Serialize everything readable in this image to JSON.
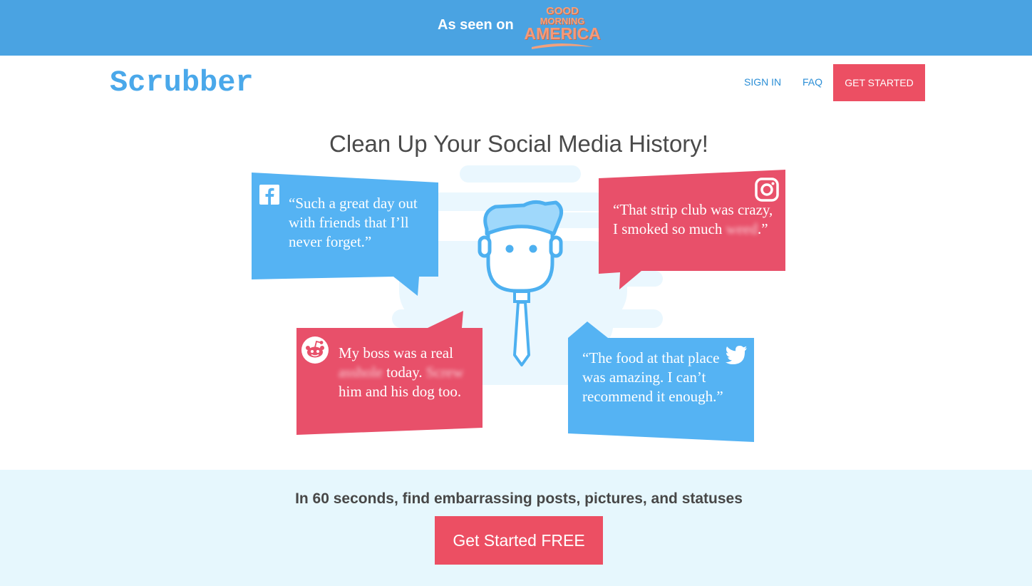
{
  "banner": {
    "as_seen_on": "As seen on",
    "logo_line1": "GOOD",
    "logo_line2": "MORNING",
    "logo_line3": "AMERICA"
  },
  "nav": {
    "brand": "Scrubber",
    "sign_in": "SIGN IN",
    "faq": "FAQ",
    "get_started": "GET STARTED"
  },
  "hero": {
    "title": "Clean Up Your Social Media History!",
    "quotes": {
      "facebook": "“Such a great day out with friends that I’ll never forget.”",
      "instagram": {
        "before": "“That strip club was crazy, I smoked so much ",
        "blurred": "weed",
        "after": ".”"
      },
      "reddit": {
        "part1": "My boss was a real ",
        "blurred1": "asshole",
        "part2": " today. ",
        "blurred2": "Screw",
        "part3": " him and his dog too."
      },
      "twitter": "“The food at that place was amazing. I can’t recommend it enough.”"
    }
  },
  "cta": {
    "tagline": "In 60 seconds, find embarrassing posts, pictures, and statuses",
    "button": "Get Started FREE"
  },
  "icons": {
    "facebook": "facebook-icon",
    "instagram": "instagram-icon",
    "reddit": "reddit-icon",
    "twitter": "twitter-icon"
  },
  "colors": {
    "banner_blue": "#4aa3e2",
    "brand_blue": "#4aa8ea",
    "accent_red": "#ec4f63",
    "bubble_blue": "#55b3f3",
    "bubble_red": "#e8506a",
    "band_bg": "#e6f7fd"
  }
}
